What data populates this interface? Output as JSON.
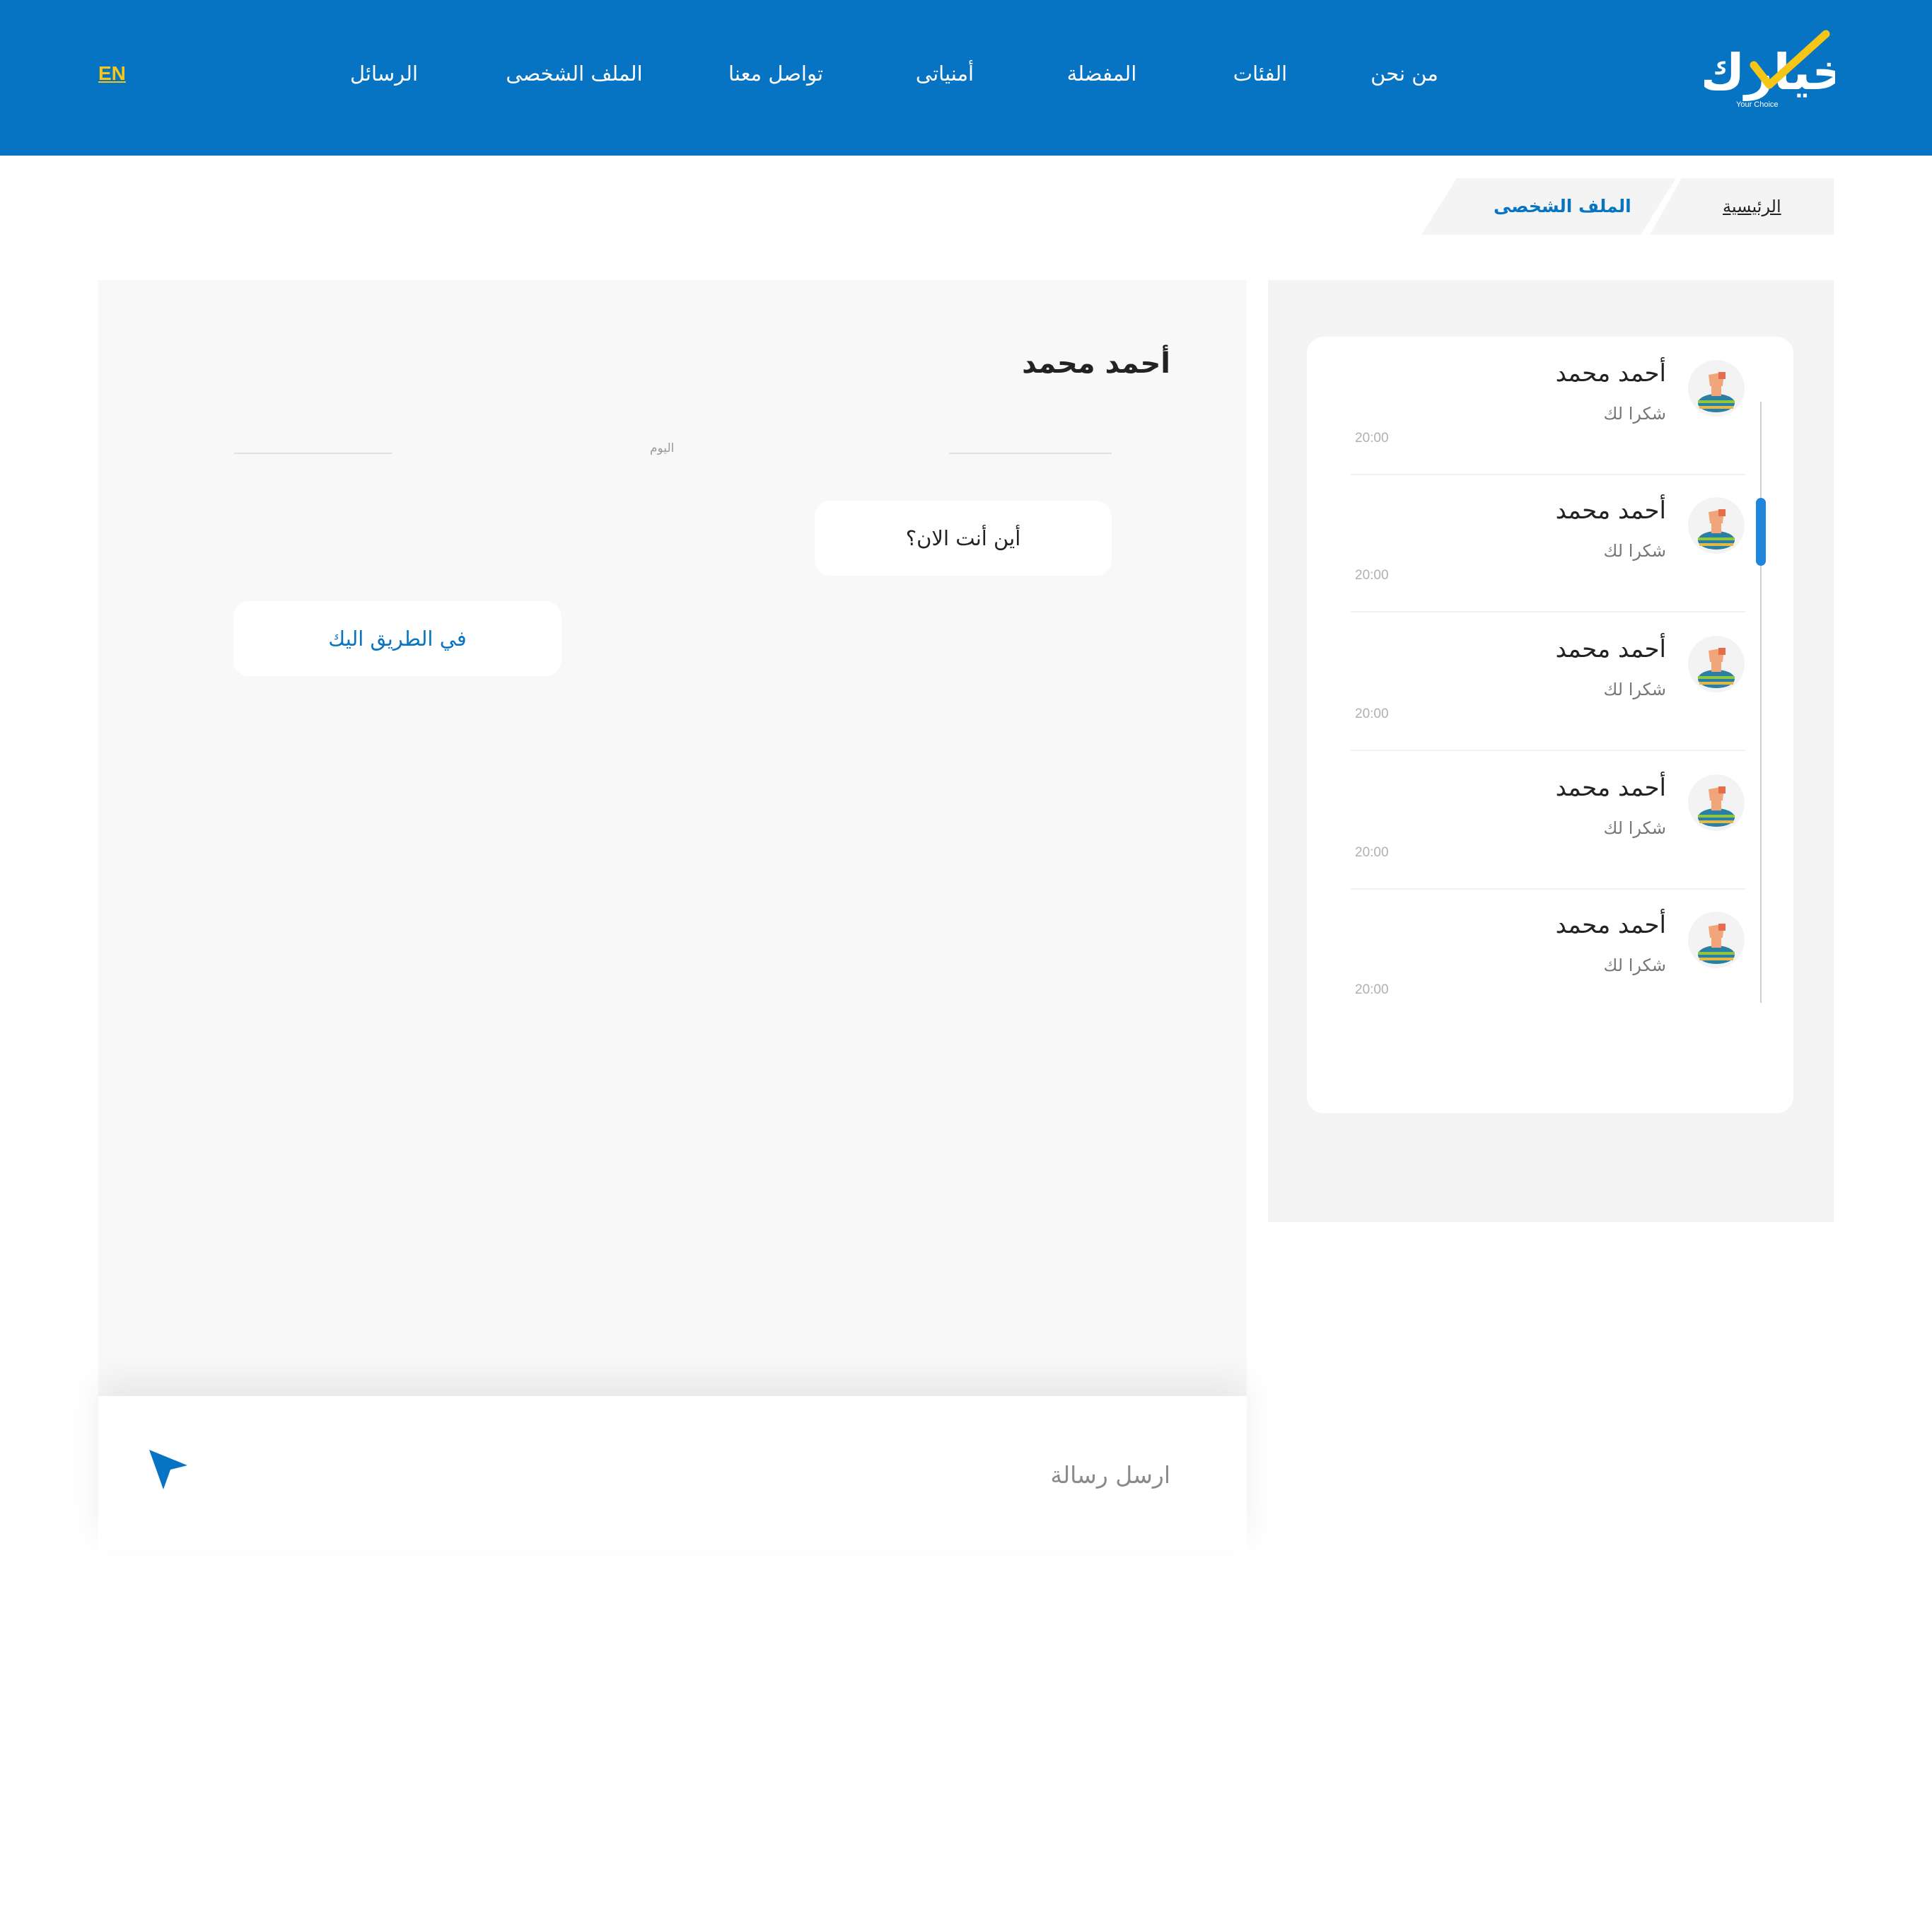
{
  "header": {
    "logo_text": "خيارك",
    "logo_tagline": "Your Choice",
    "nav": [
      {
        "label": "من نحن",
        "name": "nav-about"
      },
      {
        "label": "الفئات",
        "name": "nav-categories"
      },
      {
        "label": "المفضلة",
        "name": "nav-favorites"
      },
      {
        "label": "أمنياتى",
        "name": "nav-wishes"
      },
      {
        "label": "تواصل معنا",
        "name": "nav-contact"
      },
      {
        "label": "الملف الشخصى",
        "name": "nav-profile"
      },
      {
        "label": "الرسائل",
        "name": "nav-messages"
      }
    ],
    "language_toggle": "EN"
  },
  "breadcrumb": {
    "home": "الرئيسية",
    "current": "الملف الشخصى"
  },
  "chat": {
    "contact_name": "أحمد محمد",
    "day_label": "اليوم",
    "messages": [
      {
        "direction": "incoming",
        "text": "أين أنت الان؟"
      },
      {
        "direction": "outgoing",
        "text": "في الطريق اليك"
      }
    ],
    "composer_placeholder": "ارسل رسالة"
  },
  "conversations": [
    {
      "name": "أحمد محمد",
      "last_message": "شكرا لك",
      "time": "20:00"
    },
    {
      "name": "أحمد محمد",
      "last_message": "شكرا لك",
      "time": "20:00"
    },
    {
      "name": "أحمد محمد",
      "last_message": "شكرا لك",
      "time": "20:00"
    },
    {
      "name": "أحمد محمد",
      "last_message": "شكرا لك",
      "time": "20:00"
    },
    {
      "name": "أحمد محمد",
      "last_message": "شكرا لك",
      "time": "20:00"
    }
  ],
  "colors": {
    "brand_blue": "#0674c2",
    "accent_yellow": "#f5c518",
    "scrollbar_blue": "#1f86dc"
  },
  "icons": {
    "send": "send-arrow-icon",
    "avatar": "user-avatar-icon",
    "logo_check": "checkmark-icon"
  }
}
